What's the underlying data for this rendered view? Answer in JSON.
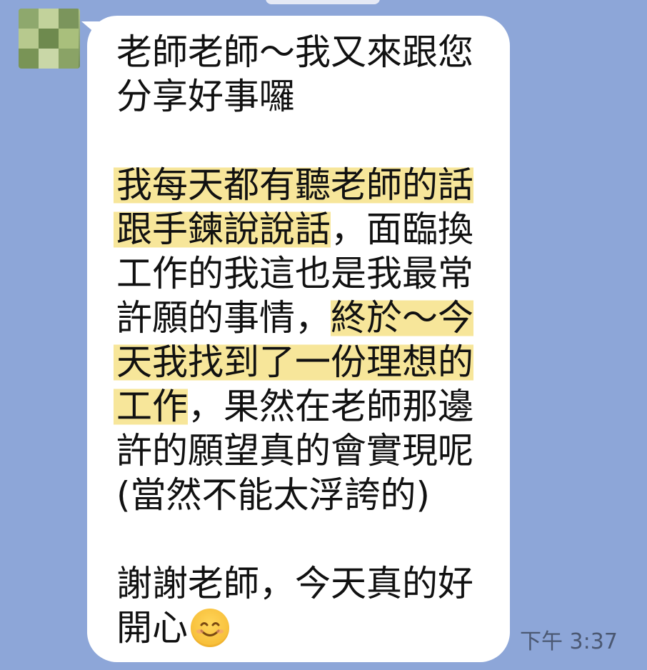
{
  "chat": {
    "message": {
      "lines": [
        [
          {
            "text": "老師老師～我又來跟您",
            "highlight": false
          }
        ],
        [
          {
            "text": "分享好事囉",
            "highlight": false
          }
        ],
        [],
        [
          {
            "text": "我",
            "highlight": false
          },
          {
            "text": "每天都有聽老師的話",
            "highlight": true
          }
        ],
        [
          {
            "text": "跟手鍊說說話",
            "highlight": true
          },
          {
            "text": "，面臨換",
            "highlight": false
          }
        ],
        [
          {
            "text": "工作的我這也是我最常",
            "highlight": false
          }
        ],
        [
          {
            "text": "許願的事情，",
            "highlight": false
          },
          {
            "text": "終於～今",
            "highlight": true
          }
        ],
        [
          {
            "text": "天我找到了一份理想的",
            "highlight": true
          }
        ],
        [
          {
            "text": "工作",
            "highlight": true
          },
          {
            "text": "，果然在老師那邊",
            "highlight": false
          }
        ],
        [
          {
            "text": "許的願望真的會實現呢",
            "highlight": false
          }
        ],
        [
          {
            "text": "(當然不能太浮誇的)",
            "highlight": false
          }
        ],
        [],
        [
          {
            "text": "謝謝老師，今天真的好",
            "highlight": false
          }
        ],
        [
          {
            "text": "開心",
            "highlight": false
          }
        ]
      ],
      "emoji": "smiling-face-emoji",
      "timestamp": "下午 3:37"
    },
    "colors": {
      "background": "#8da6d8",
      "bubble": "#ffffff",
      "highlight": "#f7e69a",
      "text": "#111111",
      "timestamp": "#4b5872"
    }
  }
}
